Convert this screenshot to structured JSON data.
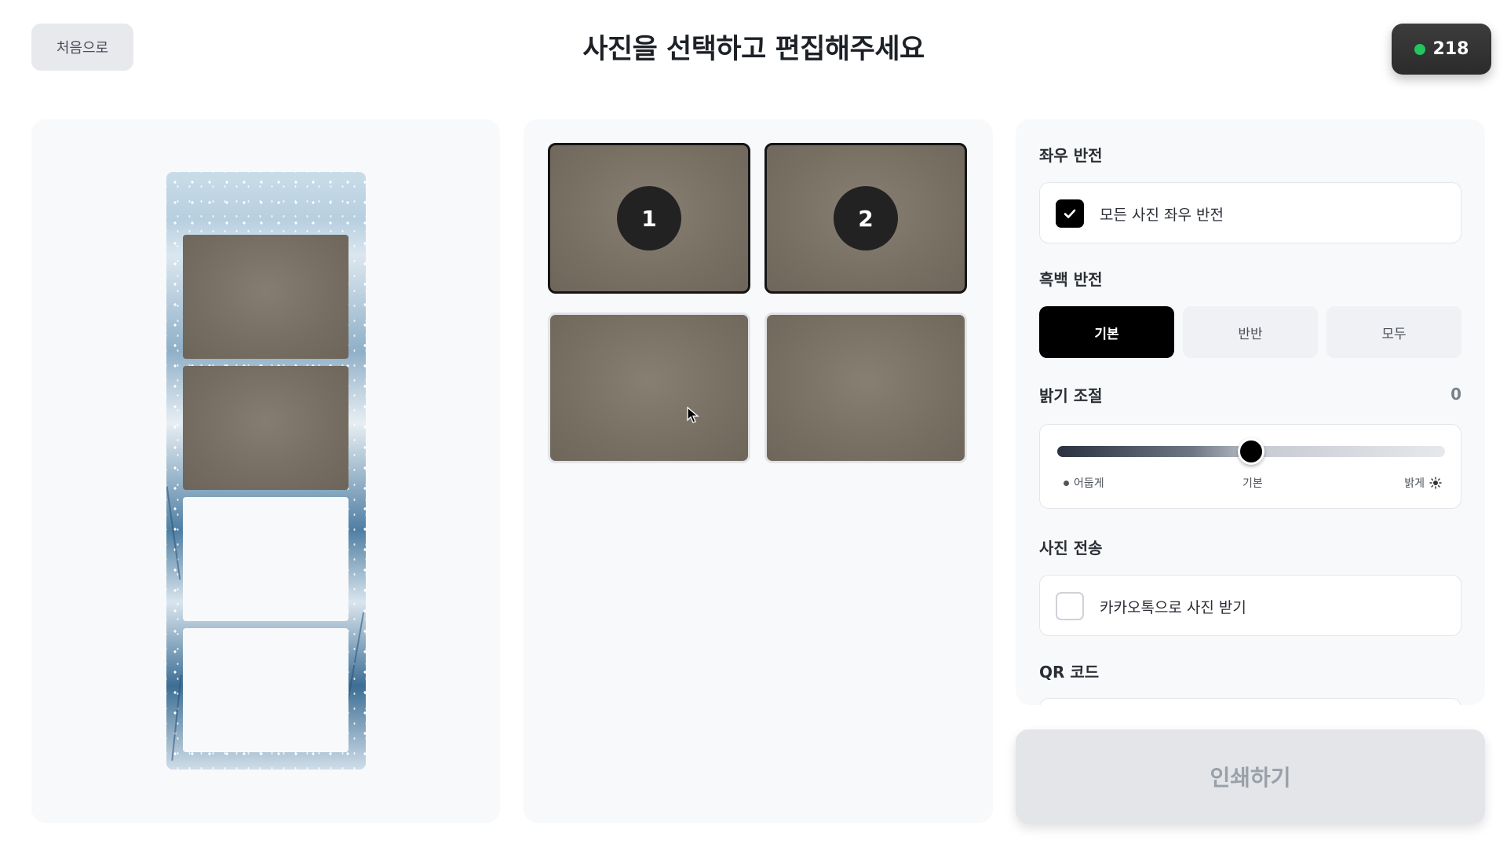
{
  "header": {
    "back_label": "처음으로",
    "title": "사진을 선택하고 편집해주세요",
    "counter": "218",
    "counter_dot_color": "#22c55e"
  },
  "grid": {
    "cells": [
      {
        "badge": "1",
        "selected": true
      },
      {
        "badge": "2",
        "selected": true
      },
      {
        "badge": "",
        "selected": false
      },
      {
        "badge": "",
        "selected": false
      }
    ]
  },
  "settings": {
    "mirror": {
      "label": "좌우 반전",
      "option": "모든 사진 좌우 반전",
      "checked": true
    },
    "bw": {
      "label": "흑백 반전",
      "options": [
        "기본",
        "반반",
        "모두"
      ],
      "selected": "기본"
    },
    "brightness": {
      "label": "밝기 조절",
      "value": "0",
      "min_label": "어둡게",
      "mid_label": "기본",
      "max_label": "밝게",
      "level": 0.5
    },
    "transfer": {
      "label": "사진 전송",
      "option": "카카오톡으로 사진 받기",
      "checked": false
    },
    "qr": {
      "label": "QR 코드"
    }
  },
  "print_label": "인쇄하기"
}
